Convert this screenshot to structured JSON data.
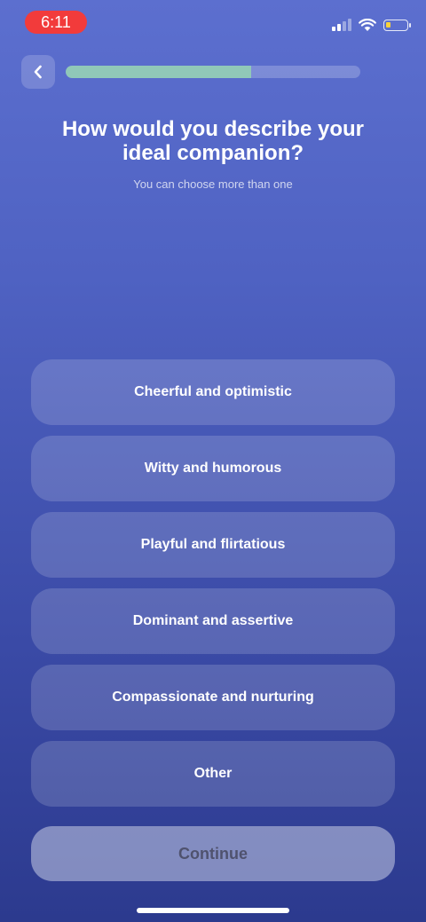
{
  "status_bar": {
    "time": "6:11",
    "icons": [
      "cellular-signal-icon",
      "wifi-icon",
      "battery-icon"
    ],
    "battery_level": 0.25,
    "time_pill_color": "#f23b3b",
    "battery_color": "#f7d13b"
  },
  "header": {
    "back_icon": "chevron-left-icon",
    "progress": 0.63,
    "progress_color": "#90c8b8"
  },
  "question": {
    "title": "How would you describe your ideal companion?",
    "subtitle": "You can choose more than one"
  },
  "options": [
    {
      "label": "Cheerful and optimistic"
    },
    {
      "label": "Witty and humorous"
    },
    {
      "label": "Playful and flirtatious"
    },
    {
      "label": "Dominant and assertive"
    },
    {
      "label": "Compassionate and nurturing"
    },
    {
      "label": "Other"
    }
  ],
  "continue_label": "Continue"
}
